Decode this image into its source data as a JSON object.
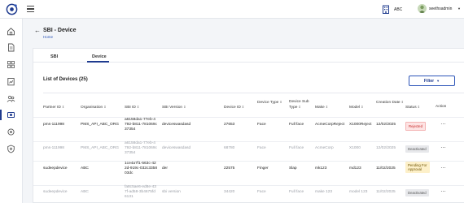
{
  "header": {
    "org_name": "ABC",
    "user_name": "seethsadmin",
    "logo_icon": "logo-icon",
    "menu_icon": "hamburger-icon"
  },
  "sidebar": {
    "icons": [
      "home-icon",
      "document-icon",
      "grid-icon",
      "report-icon",
      "users-icon",
      "device-icon",
      "settings-icon",
      "shield-icon"
    ],
    "active_index": 5
  },
  "page": {
    "title": "SBI - Device",
    "breadcrumb": "Home"
  },
  "tabs": [
    {
      "label": "SBI",
      "active": false
    },
    {
      "label": "Device",
      "active": true
    }
  ],
  "list": {
    "title": "List of Devices (25)",
    "filter_label": "Filter"
  },
  "columns": [
    {
      "label": "Partner ID",
      "sortable": true
    },
    {
      "label": "Organisation",
      "sortable": true
    },
    {
      "label": "SBI ID",
      "sortable": true
    },
    {
      "label": "SBI Version",
      "sortable": true
    },
    {
      "label": "Device ID",
      "sortable": true
    },
    {
      "label": "Device Type",
      "sortable": true
    },
    {
      "label": "Device Sub Type",
      "sortable": true
    },
    {
      "label": "Make",
      "sortable": true
    },
    {
      "label": "Model",
      "sortable": true
    },
    {
      "label": "Creation Date",
      "sortable": true
    },
    {
      "label": "Status",
      "sortable": true
    },
    {
      "label": "Action",
      "sortable": false
    }
  ],
  "rows": [
    {
      "partner_id": "pms-111998",
      "organisation": "PMS_API_ABC_ORG",
      "sbi_id": "a6158da1-77eb-4792-b811-781069c37354",
      "sbi_version": "deviceswasdasd",
      "device_id": "27653",
      "device_type": "Face",
      "device_sub_type": "Full face",
      "make": "AcmeCorpReject",
      "model": "X1000Reject",
      "creation_date": "12/02/2025",
      "status": "Rejected",
      "status_kind": "rejected",
      "faded": false
    },
    {
      "partner_id": "pms-111998",
      "organisation": "PMS_API_ABC_ORG",
      "sbi_id": "a6158da1-77eb-4792-b811-781069c37354",
      "sbi_version": "deviceswasdasd",
      "device_id": "68780",
      "device_type": "Face",
      "device_sub_type": "Full face",
      "make": "AcmeCorp",
      "model": "X1000",
      "creation_date": "12/02/2025",
      "status": "Deactivated",
      "status_kind": "deactivated",
      "faded": true
    },
    {
      "partner_id": "sudeepdevice",
      "organisation": "ABC",
      "sbi_id": "1ce4a7f1-563c-422d-919c-032c335803dc",
      "sbi_version": "der",
      "device_id": "22575",
      "device_type": "Finger",
      "device_sub_type": "Slap",
      "make": "mk123",
      "model": "md123",
      "creation_date": "11/02/2025",
      "status": "Pending For Approval",
      "status_kind": "pending",
      "faded": false
    },
    {
      "partner_id": "sudeepdevice",
      "organisation": "ABC",
      "sbi_id": "fa8c5ae6-ed8e-437f-ad58-3b4675fd6131",
      "sbi_version": "sbi version",
      "device_id": "34420",
      "device_type": "Face",
      "device_sub_type": "Full face",
      "make": "make 123",
      "model": "model 123",
      "creation_date": "11/02/2025",
      "status": "Deactivated",
      "status_kind": "deactivated",
      "faded": true
    }
  ],
  "colors": {
    "accent": "#1f3b8f",
    "link": "#2d55b8",
    "rejected": "#c62828",
    "pending_bg": "#fdf0c9",
    "deactivated_bg": "#e7e8eb"
  }
}
